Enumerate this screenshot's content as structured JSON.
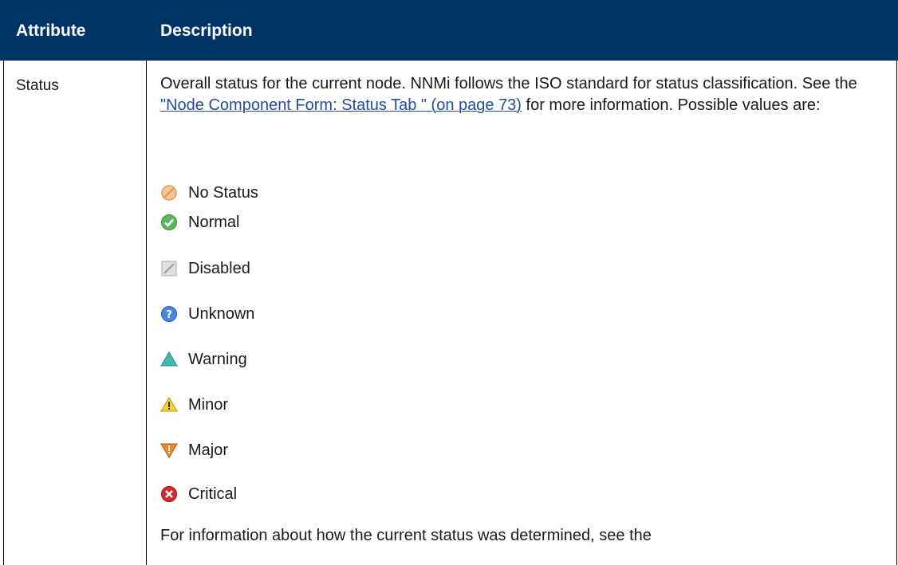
{
  "table": {
    "header": {
      "attribute_label": "Attribute",
      "description_label": "Description"
    },
    "row": {
      "attribute": "Status",
      "description_part1": "Overall status for the current node. NNMi follows the ISO standard for status classification. See the ",
      "link_text": "\"Node Component Form: Status Tab \" (on page 73)",
      "description_part2": " for more information. Possible values are:",
      "statuses": [
        {
          "label": "No Status",
          "icon": "no-status-icon",
          "color": "#f0a868"
        },
        {
          "label": "Normal",
          "icon": "normal-icon",
          "color": "#4caf50"
        },
        {
          "label": "Disabled",
          "icon": "disabled-icon",
          "color": "#bdbdbd"
        },
        {
          "label": "Unknown",
          "icon": "unknown-icon",
          "color": "#3f7fd8"
        },
        {
          "label": "Warning",
          "icon": "warning-icon",
          "color": "#3fb8b0"
        },
        {
          "label": "Minor",
          "icon": "minor-icon",
          "color": "#f5d430"
        },
        {
          "label": "Major",
          "icon": "major-icon",
          "color": "#f08a2a"
        },
        {
          "label": "Critical",
          "icon": "critical-icon",
          "color": "#d9262a"
        }
      ],
      "footer_text": "For information about how the current status was determined, see the"
    }
  },
  "colors": {
    "header_bg": "#003366",
    "link": "#1f4e9a"
  }
}
